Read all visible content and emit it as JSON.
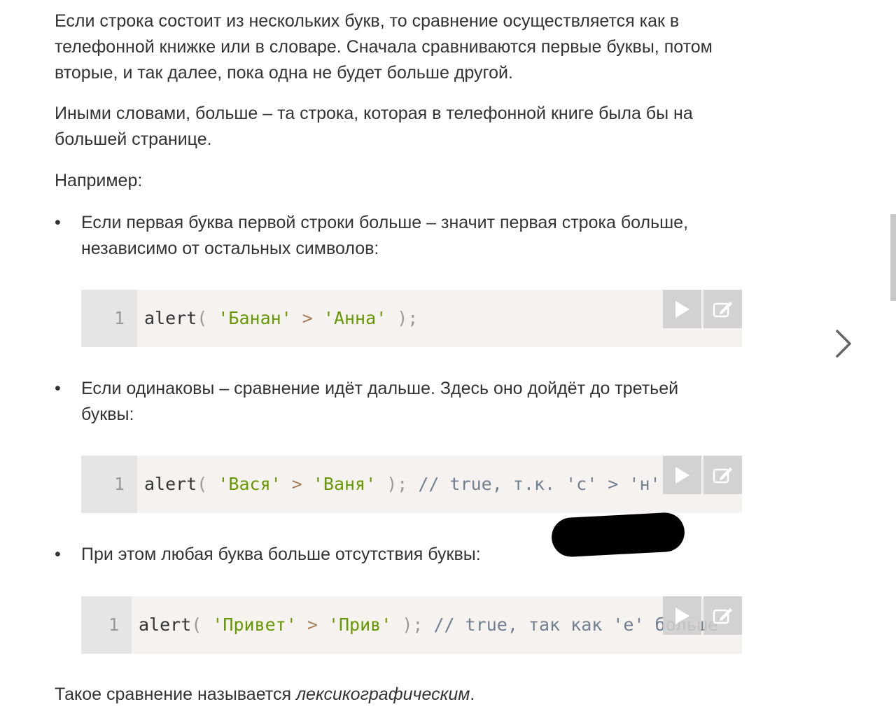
{
  "content": {
    "para1": "Если строка состоит из нескольких букв, то сравнение осуществляется как в телефонной книжке или в словаре. Сначала сравниваются первые буквы, потом вторые, и так далее, пока одна не будет больше другой.",
    "para2": "Иными словами, больше – та строка, которая в телефонной книге была бы на большей странице.",
    "para3": "Например:",
    "bullet_symbol": "•",
    "bullets": [
      "Если первая буква первой строки больше – значит первая строка больше, независимо от остальных символов:",
      "Если одинаковы – сравнение идёт дальше. Здесь оно дойдёт до третьей буквы:",
      "При этом любая буква больше отсутствия буквы:"
    ],
    "final_prefix": "Такое сравнение называется ",
    "final_em": "лексикографическим",
    "final_suffix": "."
  },
  "code_blocks": [
    {
      "line_number": "1",
      "tokens": {
        "fn": "alert",
        "open": "( ",
        "s1": "'Банан'",
        "op": " > ",
        "s2": "'Анна'",
        "close": " );"
      }
    },
    {
      "line_number": "1",
      "tokens": {
        "fn": "alert",
        "open": "( ",
        "s1": "'Вася'",
        "op": " > ",
        "s2": "'Ваня'",
        "close": " ); ",
        "comment": "// true, т.к. 'с' > 'н'"
      }
    },
    {
      "line_number": "1",
      "tokens": {
        "fn": "alert",
        "open": "( ",
        "s1": "'Привет'",
        "op": " > ",
        "s2": "'Прив'",
        "close": " ); ",
        "comment": "// true, так как 'е' больше"
      }
    }
  ],
  "icons": {
    "run": "play-icon",
    "edit": "edit-icon",
    "next": "chevron-right-icon"
  },
  "colors": {
    "text": "#333333",
    "code_bg": "#f5f2f0",
    "gutter_bg": "#e7e5e3",
    "string": "#669900",
    "comment": "#708090",
    "operator": "#a67f59"
  }
}
